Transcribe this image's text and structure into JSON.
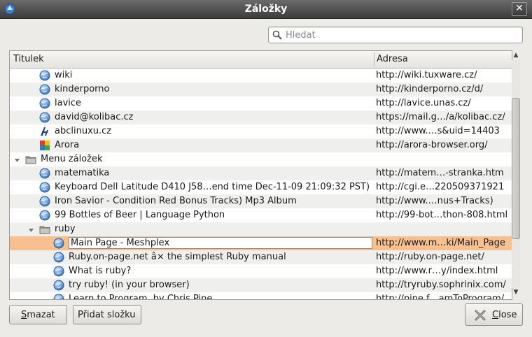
{
  "window": {
    "title": "Záložky"
  },
  "search": {
    "placeholder": "Hledat"
  },
  "columns": {
    "title": "Titulek",
    "address": "Adresa"
  },
  "rows": [
    {
      "title": "wiki",
      "url": "http://wiki.tuxware.cz/",
      "icon": "globe-icon",
      "level": 1
    },
    {
      "title": "kinderporno",
      "url": "http://kinderporno.cz/d/",
      "icon": "globe-icon",
      "level": 1
    },
    {
      "title": "lavice",
      "url": "http://lavice.unas.cz/",
      "icon": "globe-icon",
      "level": 1
    },
    {
      "title": "david@kolibac.cz",
      "url": "https://mail.g…/a/kolibac.cz/",
      "icon": "globe-icon",
      "level": 1
    },
    {
      "title": "abclinuxu.cz",
      "url": "http://www.…s&uid=14403",
      "icon": "abclinuxu-icon",
      "level": 1
    },
    {
      "title": "Arora",
      "url": "http://arora-browser.org/",
      "icon": "arora-icon",
      "level": 1
    },
    {
      "title": "Menu záložek",
      "url": "",
      "icon": "folder-icon",
      "level": 0,
      "expandable": true
    },
    {
      "title": "matematika",
      "url": "http://matem…-stranka.htm",
      "icon": "globe-icon",
      "level": 1
    },
    {
      "title": "Keyboard Dell Latitude D410 J58…end time Dec-11-09 21:09:32 PST)",
      "url": "http://cgi.e…220509371921",
      "icon": "globe-icon",
      "level": 1
    },
    {
      "title": "Iron Savior - Condition Red Bonus Tracks) Mp3 Album",
      "url": "http://www.…nus+Tracks)",
      "icon": "globe-icon",
      "level": 1
    },
    {
      "title": "99 Bottles of Beer | Language Python",
      "url": "http://99-bot…thon-808.html",
      "icon": "globe-icon",
      "level": 1
    },
    {
      "title": "ruby",
      "url": "",
      "icon": "folder-icon",
      "level": 1,
      "expandable": true
    },
    {
      "title": "Main Page - Meshplex",
      "url": "http://www.m…ki/Main_Page",
      "icon": "globe-icon",
      "level": 2,
      "selected": true,
      "editing": true
    },
    {
      "title": "Ruby.on-page.net â⨯ the simplest Ruby manual",
      "url": "http://ruby.on-page.net/",
      "icon": "globe-icon",
      "level": 2
    },
    {
      "title": "What is ruby?",
      "url": "http://www.r…y/index.html",
      "icon": "globe-icon",
      "level": 2
    },
    {
      "title": "try ruby! (in your browser)",
      "url": "http://tryruby.sophrinix.com/",
      "icon": "globe-icon",
      "level": 2
    },
    {
      "title": "Learn to Program, by Chris Pine",
      "url": "http://pine.f…amToProgram/",
      "icon": "globe-icon",
      "level": 2
    }
  ],
  "buttons": {
    "delete": {
      "mnemonic": "S",
      "rest": "mazat"
    },
    "add_folder": "Přidat složku",
    "close": {
      "mnemonic": "C",
      "rest": "lose"
    }
  },
  "colors": {
    "selection": "#f7c08e",
    "titlebar": "#4a4a4a"
  }
}
